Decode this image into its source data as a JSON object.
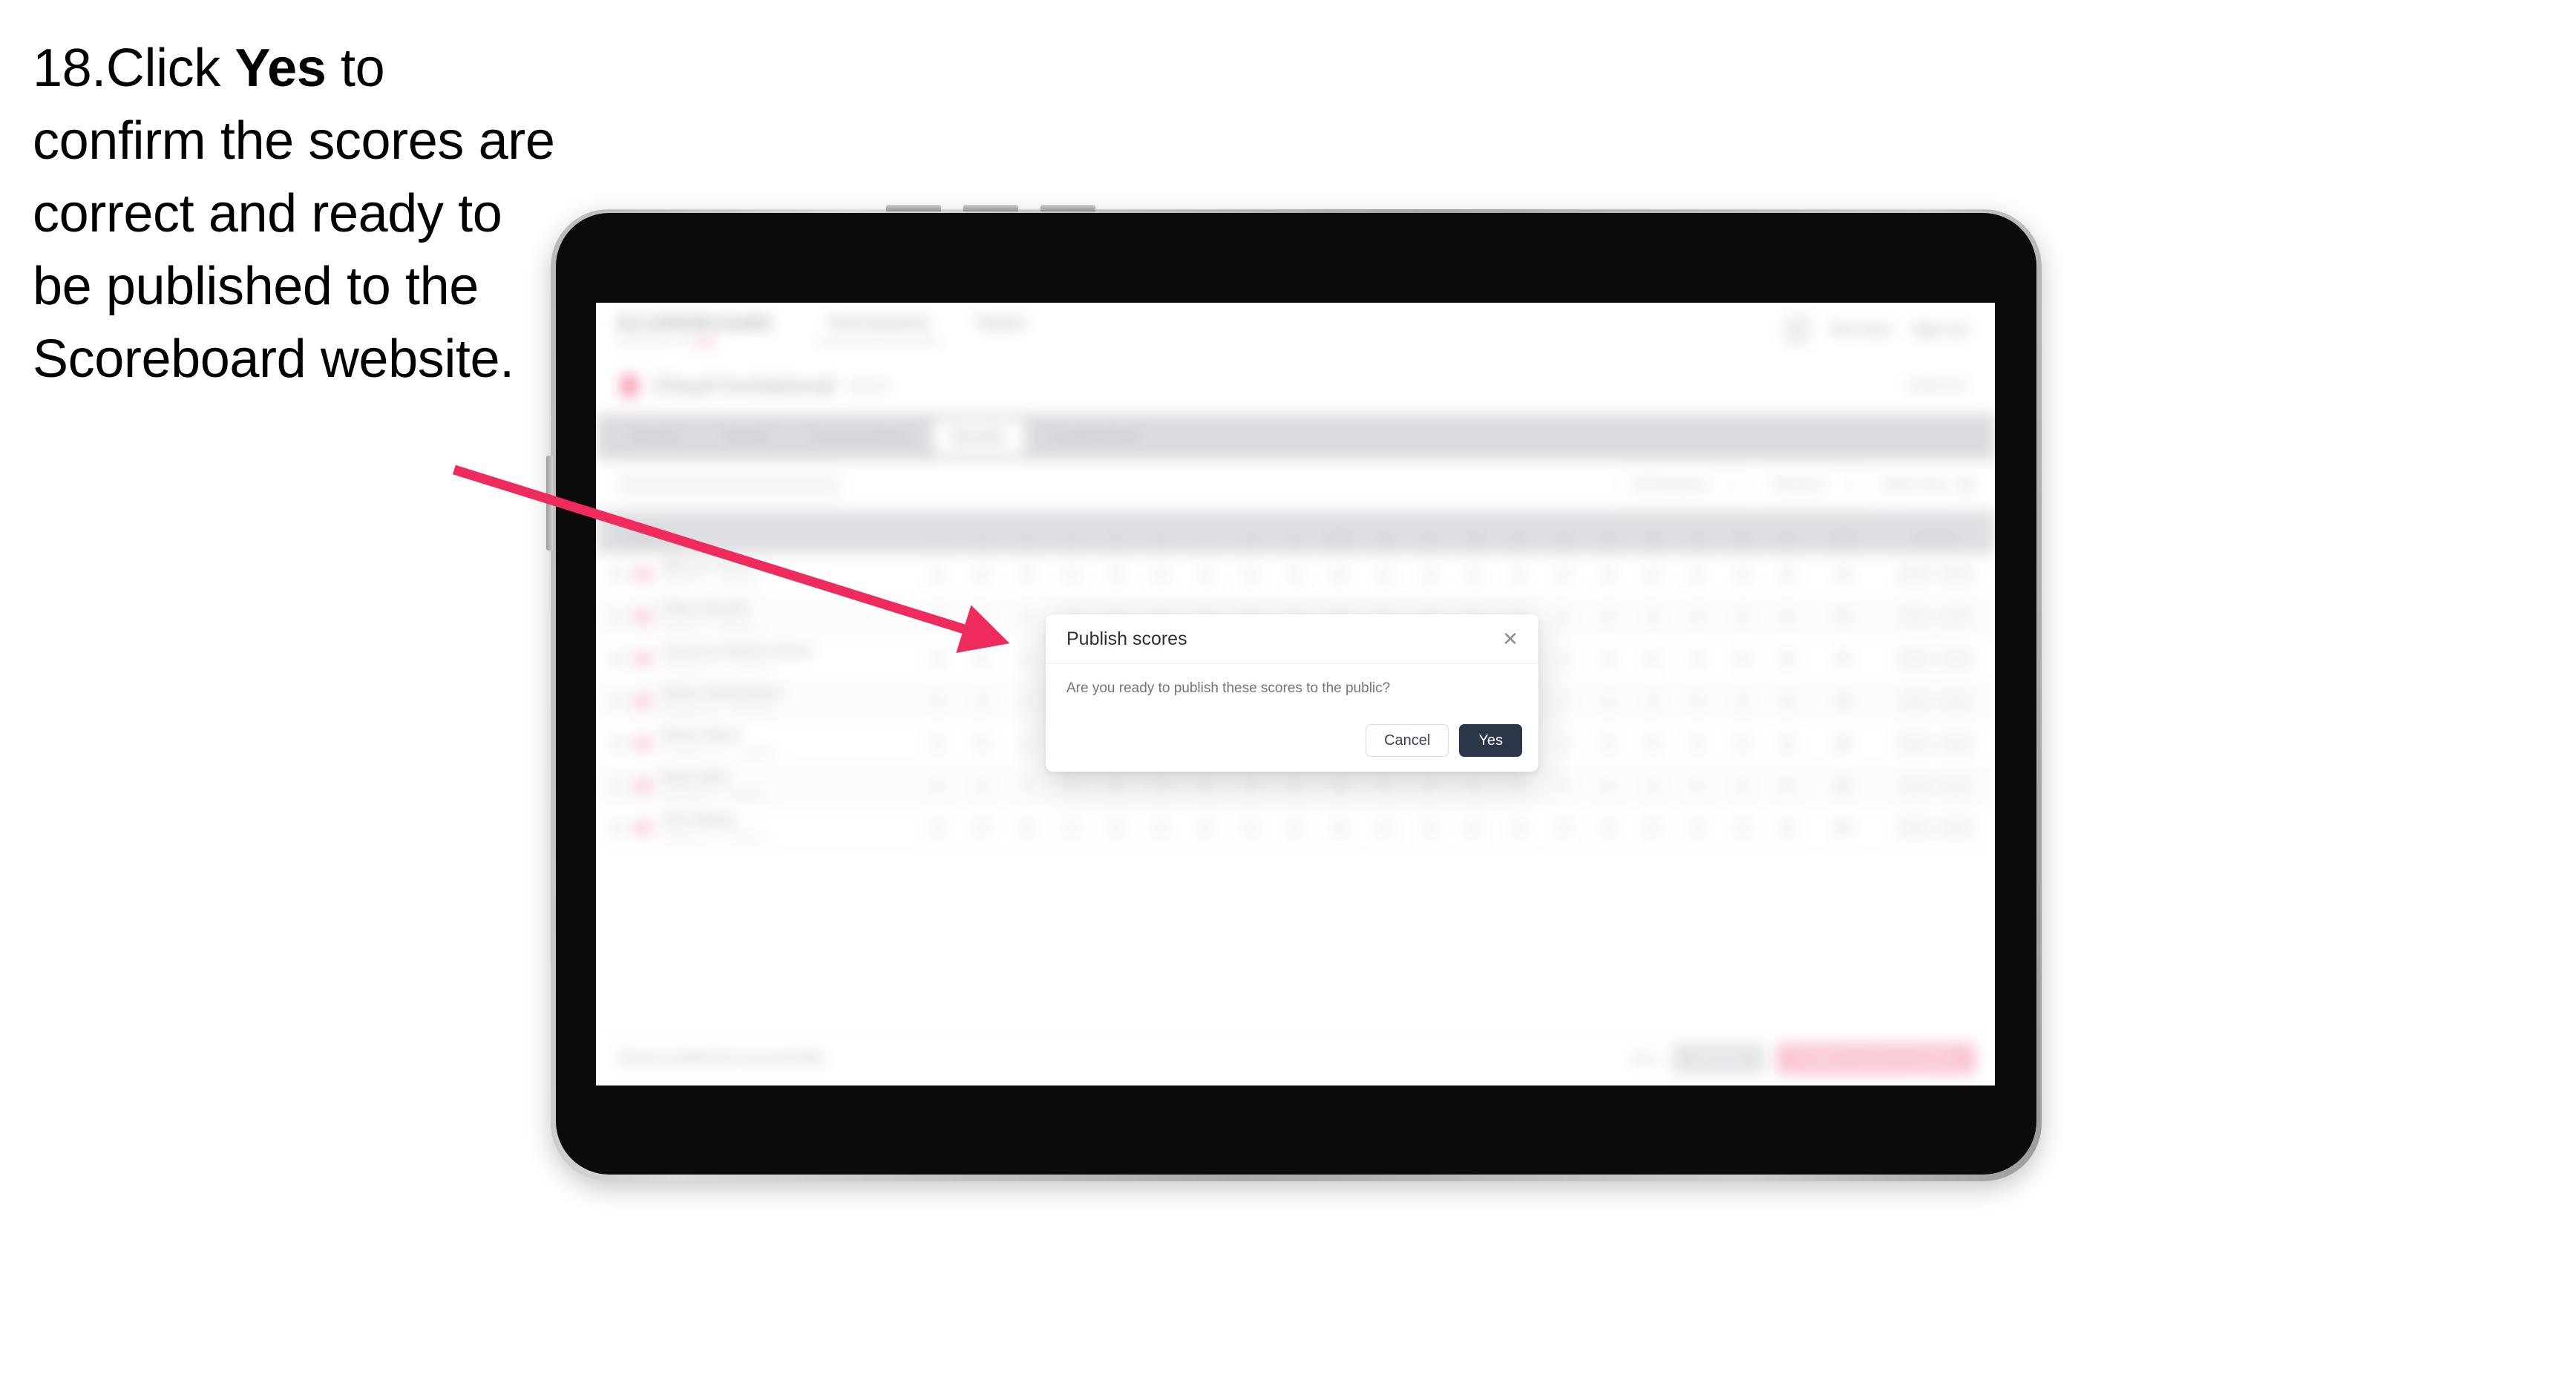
{
  "instruction": {
    "number": "18.",
    "part1": "Click ",
    "bold": "Yes",
    "part2": " to confirm the scores are correct and ready to be published to the Scoreboard website."
  },
  "colors": {
    "arrow": "#ef2b5e",
    "primary_button": "#2b3648",
    "brand_pink": "#ef5182",
    "cancel_border": "#cfdcf2"
  },
  "app": {
    "header": {
      "logo": "SCOREBOARD",
      "logo_sub": "POWERED BY",
      "logo_sub_brand": "LIVE",
      "nav": [
        {
          "label": "Tournaments",
          "active": true
        },
        {
          "label": "Teams",
          "active": false
        }
      ],
      "account_name": "Test User",
      "sign_out": "Sign out"
    },
    "title_row": {
      "title": "Clwyd Invitational",
      "subtitle": "2024",
      "right_label": "Event ID"
    },
    "tabs": [
      {
        "label": "Details",
        "selected": false
      },
      {
        "label": "Teams",
        "selected": false
      },
      {
        "label": "Course Setup",
        "selected": false
      },
      {
        "label": "Results",
        "selected": true
      },
      {
        "label": "Leaderboard",
        "selected": false
      }
    ],
    "filters": {
      "search_placeholder": "Search",
      "selects": [
        {
          "label": "All Divisions"
        },
        {
          "label": "Round 1"
        }
      ],
      "action": "Table View"
    },
    "table": {
      "headers": {
        "player": "Player",
        "holes": [
          "1",
          "2",
          "3",
          "4",
          "5",
          "6",
          "7",
          "8",
          "9",
          "OUT",
          "10",
          "11",
          "12",
          "13",
          "14",
          "15",
          "16",
          "17",
          "18",
          "IN"
        ],
        "total": "Total",
        "actions": "Actions"
      },
      "rows": [
        {
          "name": "Warren Turner",
          "sub": "Clwyd G.C. · Division 1",
          "scores": [
            "4",
            "5",
            "3",
            "4",
            "4",
            "5",
            "4",
            "3",
            "5",
            "37",
            "4",
            "4",
            "3",
            "5",
            "4",
            "4",
            "3",
            "5",
            "4",
            "36"
          ],
          "total": "73",
          "par": "+1",
          "actions": [
            "Edit",
            "View"
          ]
        },
        {
          "name": "Peter Parnell",
          "sub": "Clwyd G.C. · Division 1",
          "scores": [
            "5",
            "4",
            "4",
            "3",
            "5",
            "4",
            "4",
            "4",
            "4",
            "37",
            "5",
            "3",
            "4",
            "4",
            "5",
            "4",
            "4",
            "4",
            "4",
            "37"
          ],
          "total": "74",
          "par": "+2",
          "actions": [
            "Edit",
            "View"
          ]
        },
        {
          "name": "Cameron Barker-Davis",
          "sub": "Prestatyn G.C. · Division 1",
          "scores": [
            "4",
            "5",
            "4",
            "4",
            "4",
            "4",
            "5",
            "3",
            "5",
            "38",
            "4",
            "4",
            "4",
            "5",
            "4",
            "5",
            "3",
            "4",
            "5",
            "38"
          ],
          "total": "76",
          "par": "+4",
          "actions": [
            "Edit",
            "View"
          ]
        },
        {
          "name": "Oliver Richardson",
          "sub": "Rhuddlan G.C. · Division 2",
          "scores": [
            "5",
            "4",
            "5",
            "4",
            "4",
            "5",
            "4",
            "4",
            "4",
            "39",
            "5",
            "4",
            "4",
            "4",
            "5",
            "4",
            "4",
            "5",
            "4",
            "39"
          ],
          "total": "78",
          "par": "+6",
          "actions": [
            "Edit",
            "View"
          ]
        },
        {
          "name": "Ethan Ward",
          "sub": "Llandudno G.C. · Division 2",
          "scores": [
            "4",
            "5",
            "4",
            "5",
            "5",
            "4",
            "4",
            "4",
            "5",
            "40",
            "4",
            "5",
            "4",
            "5",
            "4",
            "4",
            "5",
            "4",
            "5",
            "40"
          ],
          "total": "80",
          "par": "+8",
          "actions": [
            "Edit",
            "View"
          ]
        },
        {
          "name": "Ryan Ellis",
          "sub": "Denbigh G.C. · Division 2",
          "scores": [
            "5",
            "5",
            "4",
            "4",
            "5",
            "5",
            "4",
            "4",
            "5",
            "41",
            "5",
            "4",
            "5",
            "4",
            "5",
            "5",
            "4",
            "4",
            "5",
            "41"
          ],
          "total": "82",
          "par": "+10",
          "actions": [
            "Edit",
            "View"
          ]
        },
        {
          "name": "Alex Bailey",
          "sub": "Northop G.C. · Division 2",
          "scores": [
            "5",
            "4",
            "5",
            "5",
            "4",
            "5",
            "5",
            "4",
            "5",
            "42",
            "4",
            "5",
            "5",
            "5",
            "4",
            "5",
            "5",
            "4",
            "5",
            "42"
          ],
          "total": "84",
          "par": "+12",
          "actions": [
            "Edit",
            "View"
          ]
        }
      ]
    },
    "bottom_bar": {
      "note": "Scores published successfully",
      "link": "Back",
      "secondary_button": "Save All",
      "primary_button": "Publish scores to public"
    }
  },
  "modal": {
    "title": "Publish scores",
    "close_icon": "close-icon",
    "body": "Are you ready to publish these scores to the public?",
    "cancel_label": "Cancel",
    "yes_label": "Yes"
  }
}
